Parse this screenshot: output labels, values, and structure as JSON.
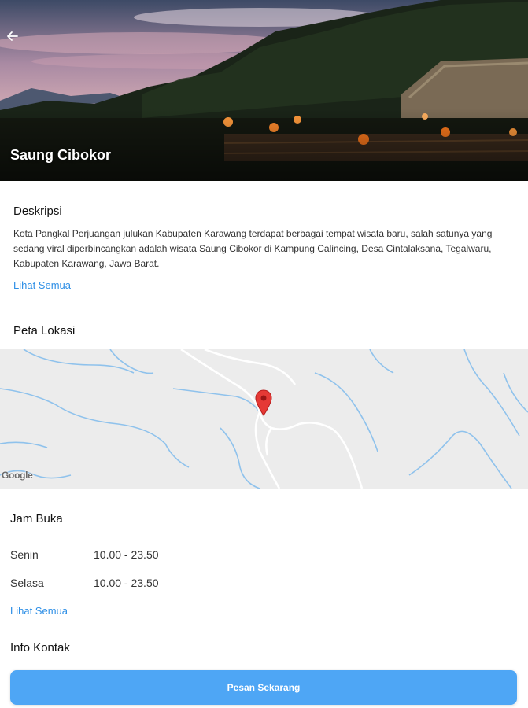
{
  "header": {
    "title": "Saung Cibokor",
    "back_icon": "arrow-left-icon"
  },
  "description": {
    "heading": "Deskripsi",
    "text": "Kota Pangkal Perjuangan julukan Kabupaten Karawang terdapat berbagai tempat wisata baru, salah satunya yang sedang viral diperbincangkan adalah wisata Saung Cibokor di Kampung Calincing, Desa Cintalaksana, Tegalwaru, Kabupaten Karawang, Jawa Barat.",
    "see_all": "Lihat Semua"
  },
  "map": {
    "heading": "Peta Lokasi",
    "attribution": "Google",
    "pin_color": "#e53935"
  },
  "hours": {
    "heading": "Jam Buka",
    "rows": [
      {
        "day": "Senin",
        "time": "10.00 - 23.50"
      },
      {
        "day": "Selasa",
        "time": "10.00 - 23.50"
      }
    ],
    "see_all": "Lihat Semua"
  },
  "contact": {
    "heading": "Info Kontak"
  },
  "cta": {
    "label": "Pesan Sekarang",
    "color": "#4ea6f5"
  },
  "colors": {
    "link": "#2e8fe6"
  }
}
